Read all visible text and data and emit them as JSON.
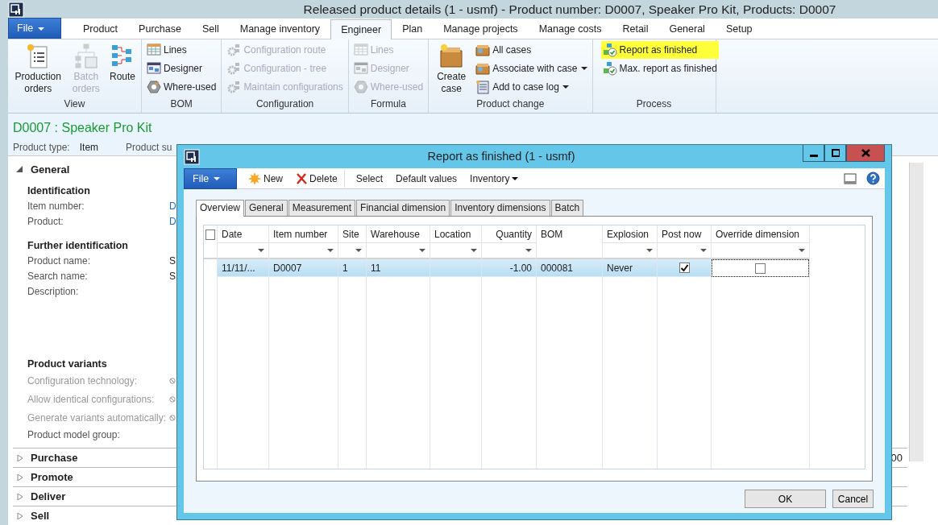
{
  "window": {
    "title": "Released product details (1 - usmf) - Product number: D0007, Speaker Pro Kit, Products: D0007"
  },
  "ribbon_tabs": [
    {
      "label": "File",
      "kind": "file",
      "selected": false
    },
    {
      "label": "Product",
      "selected": false
    },
    {
      "label": "Purchase",
      "selected": false
    },
    {
      "label": "Sell",
      "selected": false
    },
    {
      "label": "Manage inventory",
      "selected": false
    },
    {
      "label": "Engineer",
      "selected": true
    },
    {
      "label": "Plan",
      "selected": false
    },
    {
      "label": "Manage projects",
      "selected": false
    },
    {
      "label": "Manage costs",
      "selected": false
    },
    {
      "label": "Retail",
      "selected": false
    },
    {
      "label": "General",
      "selected": false
    },
    {
      "label": "Setup",
      "selected": false
    }
  ],
  "ribbon_groups": [
    {
      "label": "View",
      "items": [
        {
          "label": "Production orders",
          "kind": "large",
          "disabled": false
        },
        {
          "label": "Batch orders",
          "kind": "large",
          "disabled": true
        },
        {
          "label": "Route",
          "kind": "large",
          "disabled": false
        }
      ]
    },
    {
      "label": "BOM",
      "items": [
        {
          "label": "Lines",
          "kind": "small",
          "disabled": false
        },
        {
          "label": "Designer",
          "kind": "small",
          "disabled": false
        },
        {
          "label": "Where-used",
          "kind": "small",
          "disabled": false
        }
      ]
    },
    {
      "label": "Configuration",
      "items": [
        {
          "label": "Configuration route",
          "kind": "small",
          "disabled": true
        },
        {
          "label": "Configuration - tree",
          "kind": "small",
          "disabled": true
        },
        {
          "label": "Maintain configurations",
          "kind": "small",
          "disabled": true
        }
      ]
    },
    {
      "label": "Formula",
      "items": [
        {
          "label": "Lines",
          "kind": "small",
          "disabled": true
        },
        {
          "label": "Designer",
          "kind": "small",
          "disabled": true
        },
        {
          "label": "Where-used",
          "kind": "small",
          "disabled": true
        }
      ]
    },
    {
      "label": "Product change",
      "items": [
        {
          "label": "Create case",
          "kind": "large",
          "disabled": false
        },
        {
          "label": "All cases",
          "kind": "small",
          "disabled": false
        },
        {
          "label": "Associate with case",
          "kind": "small",
          "disabled": false,
          "dropdown": true
        },
        {
          "label": "Add to case log",
          "kind": "small",
          "disabled": false,
          "dropdown": true
        }
      ]
    },
    {
      "label": "Process",
      "items": [
        {
          "label": "Report as finished",
          "kind": "small",
          "disabled": false,
          "highlighted": true
        },
        {
          "label": "Max. report as finished",
          "kind": "small",
          "disabled": false
        }
      ]
    }
  ],
  "header": {
    "title": "D0007 : Speaker Pro Kit",
    "summary": [
      {
        "label": "Product type:",
        "value": "Item"
      },
      {
        "label": "Product su"
      }
    ]
  },
  "fasttabs": [
    {
      "label": "General",
      "expanded": true,
      "groups": [
        {
          "label": "Identification",
          "fields": [
            {
              "label": "Item number:",
              "value": "D",
              "kind": "link"
            },
            {
              "label": "Product:",
              "value": "D",
              "kind": "link"
            }
          ]
        },
        {
          "label": "Further identification",
          "fields": [
            {
              "label": "Product name:",
              "value": "S",
              "kind": "text"
            },
            {
              "label": "Search name:",
              "value": "S",
              "kind": "text"
            },
            {
              "label": "Description:",
              "kind": "text"
            }
          ]
        },
        {
          "label": "Product variants",
          "fields": [
            {
              "label": "Configuration technology:",
              "kind": "checkbox",
              "disabled": true
            },
            {
              "label": "Allow identical configurations:",
              "kind": "checkbox",
              "disabled": true
            },
            {
              "label": "Generate variants automatically:",
              "kind": "checkbox",
              "disabled": true
            },
            {
              "label": "Product model group:",
              "kind": "text",
              "disabled": false
            }
          ]
        }
      ]
    },
    {
      "label": "Purchase",
      "expanded": false,
      "summary": "00"
    },
    {
      "label": "Promote",
      "expanded": false
    },
    {
      "label": "Deliver",
      "expanded": false
    },
    {
      "label": "Sell",
      "expanded": false
    }
  ],
  "dialog": {
    "title": "Report as finished (1 - usmf)",
    "toolbar": [
      {
        "label": "File",
        "kind": "file"
      },
      {
        "label": "New",
        "kind": "new"
      },
      {
        "label": "Delete",
        "kind": "delete"
      },
      {
        "label": "Select",
        "kind": "plain"
      },
      {
        "label": "Default values",
        "kind": "plain"
      },
      {
        "label": "Inventory",
        "kind": "menu"
      }
    ],
    "tabs": [
      {
        "label": "Overview",
        "selected": true
      },
      {
        "label": "General",
        "selected": false
      },
      {
        "label": "Measurement",
        "selected": false
      },
      {
        "label": "Financial dimension",
        "selected": false
      },
      {
        "label": "Inventory dimensions",
        "selected": false
      },
      {
        "label": "Batch",
        "selected": false
      }
    ],
    "grid": {
      "select_all": false,
      "columns": [
        {
          "label": "Date",
          "filter": true
        },
        {
          "label": "Item number",
          "filter": true
        },
        {
          "label": "Site",
          "filter": true
        },
        {
          "label": "Warehouse",
          "filter": true
        },
        {
          "label": "Location",
          "filter": true
        },
        {
          "label": "Quantity",
          "filter": true
        },
        {
          "label": "BOM",
          "filter": false
        },
        {
          "label": "Explosion",
          "filter": true
        },
        {
          "label": "Post now",
          "filter": true
        },
        {
          "label": "Override dimension",
          "filter": true
        }
      ],
      "rows": [
        {
          "selected": true,
          "cells": [
            "11/11/...",
            "D0007",
            "1",
            "11",
            "",
            "-1.00",
            "000081",
            "Never"
          ],
          "post_now": true,
          "override_dimension": false
        }
      ]
    },
    "buttons": [
      "OK",
      "Cancel"
    ]
  }
}
